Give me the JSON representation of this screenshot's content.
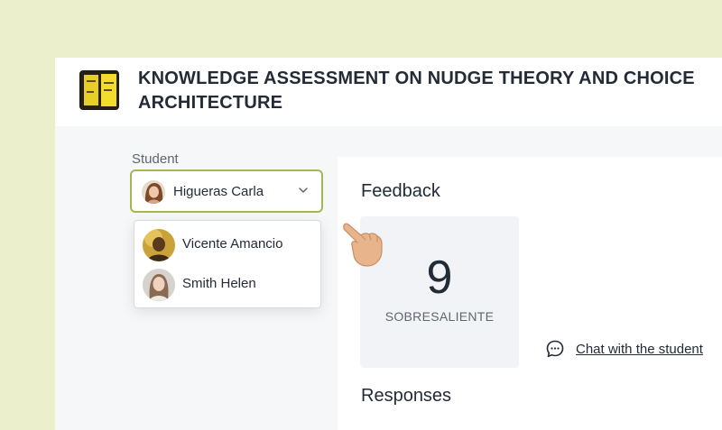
{
  "header": {
    "title": "KNOWLEDGE ASSESSMENT ON NUDGE THEORY AND CHOICE ARCHITECTURE",
    "thumbnail_icon": "book-cover-thumbnail"
  },
  "student_selector": {
    "label": "Student",
    "selected": "Higueras Carla",
    "options": [
      "Vicente Amancio",
      "Smith Helen"
    ],
    "border_color": "#a3b84f"
  },
  "feedback": {
    "title": "Feedback",
    "grade": "9",
    "grade_label": "SOBRESALIENTE"
  },
  "chat": {
    "label": "Chat with the student",
    "icon": "chat-bubble-icon"
  },
  "responses": {
    "title": "Responses"
  },
  "colors": {
    "background": "#ecefcb",
    "accent": "#a3b84f",
    "text": "#222b36"
  }
}
